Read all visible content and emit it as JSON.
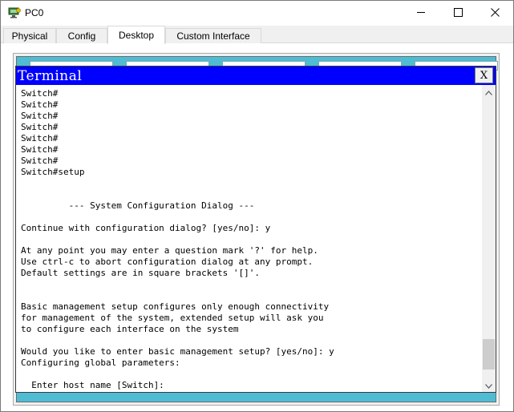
{
  "window": {
    "title": "PC0",
    "icon": "packet-tracer-pc-icon",
    "controls": [
      "minimize-icon",
      "maximize-icon",
      "close-icon"
    ]
  },
  "tabs": [
    {
      "label": "Physical",
      "active": false
    },
    {
      "label": "Config",
      "active": false
    },
    {
      "label": "Desktop",
      "active": true
    },
    {
      "label": "Custom Interface",
      "active": false
    }
  ],
  "terminal": {
    "title": "Terminal",
    "close_label": "X",
    "lines": [
      "Switch#",
      "Switch#",
      "Switch#",
      "Switch#",
      "Switch#",
      "Switch#",
      "Switch#",
      "Switch#setup",
      "",
      "",
      "         --- System Configuration Dialog ---",
      "",
      "Continue with configuration dialog? [yes/no]: y",
      "",
      "At any point you may enter a question mark '?' for help.",
      "Use ctrl-c to abort configuration dialog at any prompt.",
      "Default settings are in square brackets '[]'.",
      "",
      "",
      "Basic management setup configures only enough connectivity",
      "for management of the system, extended setup will ask you",
      "to configure each interface on the system",
      "",
      "Would you like to enter basic management setup? [yes/no]: y",
      "Configuring global parameters:",
      "",
      "  Enter host name [Switch]:"
    ]
  },
  "colors": {
    "terminal_header": "#0000ff",
    "desktop_background": "#4fbcd4"
  }
}
